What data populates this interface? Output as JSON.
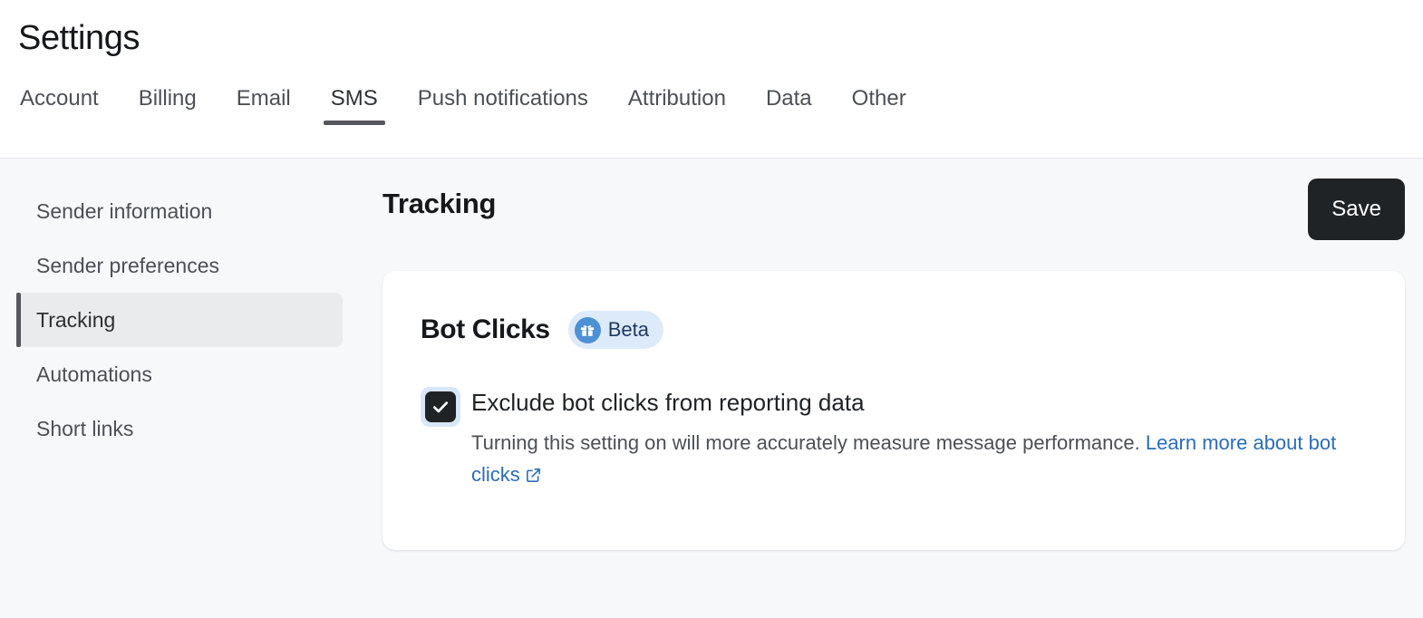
{
  "header": {
    "title": "Settings",
    "tabs": [
      {
        "label": "Account",
        "active": false
      },
      {
        "label": "Billing",
        "active": false
      },
      {
        "label": "Email",
        "active": false
      },
      {
        "label": "SMS",
        "active": true
      },
      {
        "label": "Push notifications",
        "active": false
      },
      {
        "label": "Attribution",
        "active": false
      },
      {
        "label": "Data",
        "active": false
      },
      {
        "label": "Other",
        "active": false
      }
    ]
  },
  "sidebar": {
    "items": [
      {
        "label": "Sender information",
        "active": false
      },
      {
        "label": "Sender preferences",
        "active": false
      },
      {
        "label": "Tracking",
        "active": true
      },
      {
        "label": "Automations",
        "active": false
      },
      {
        "label": "Short links",
        "active": false
      }
    ]
  },
  "main": {
    "section_title": "Tracking",
    "save_label": "Save",
    "card": {
      "title": "Bot Clicks",
      "badge_label": "Beta",
      "badge_icon": "gift-icon",
      "setting": {
        "label": "Exclude bot clicks from reporting data",
        "checked": true,
        "description": "Turning this setting on will more accurately measure message performance. ",
        "link_text": "Learn more about bot clicks",
        "link_icon": "external-link-icon"
      }
    }
  },
  "colors": {
    "page_background": "#f7f8fa",
    "header_background": "#ffffff",
    "card_background": "#ffffff",
    "accent_dark": "#202326",
    "active_bar": "#55585c",
    "sidebar_active_bg": "#eaebec",
    "badge_bg": "#dceaf9",
    "badge_icon_bg": "#4d90d6",
    "badge_text": "#1d3a63",
    "checkbox_ring": "#d6e7fa",
    "link": "#2b6cb8"
  }
}
